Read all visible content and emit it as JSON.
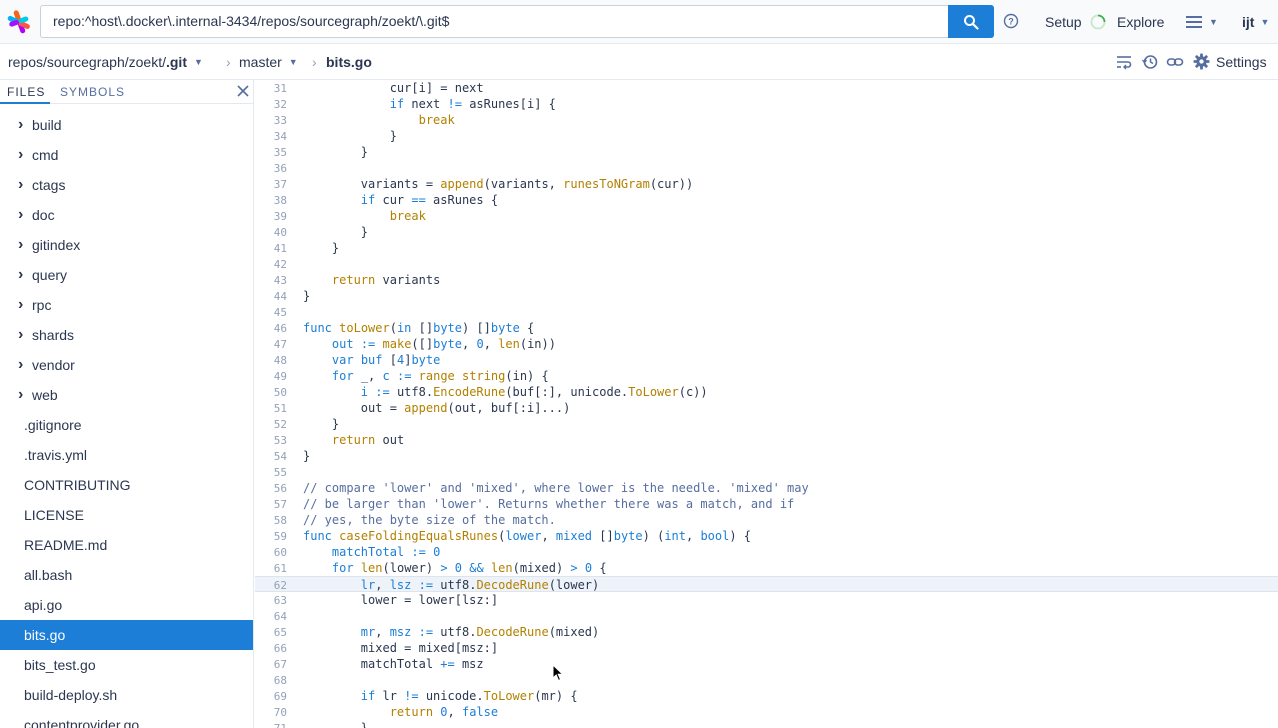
{
  "topnav": {
    "query": "repo:^host\\.docker\\.internal-3434/repos/sourcegraph/zoekt/\\.git$",
    "setup_label": "Setup",
    "explore_label": "Explore",
    "user_label": "ijt"
  },
  "repo_header": {
    "repo_prefix": "repos/sourcegraph/zoekt/",
    "repo_name": ".git",
    "branch": "master",
    "file": "bits.go",
    "settings_label": "Settings"
  },
  "sidebar": {
    "tab_files": "FILES",
    "tab_symbols": "SYMBOLS",
    "dirs": [
      "build",
      "cmd",
      "ctags",
      "doc",
      "gitindex",
      "query",
      "rpc",
      "shards",
      "vendor",
      "web"
    ],
    "files": [
      ".gitignore",
      ".travis.yml",
      "CONTRIBUTING",
      "LICENSE",
      "README.md",
      "all.bash",
      "api.go",
      "bits.go",
      "bits_test.go",
      "build-deploy.sh",
      "contentprovider.go"
    ],
    "active_file": "bits.go"
  },
  "code": {
    "first_line": 31,
    "highlighted_line": 62,
    "lines": [
      [
        [
          "            cur[i] = next",
          ""
        ]
      ],
      [
        [
          "            ",
          ""
        ],
        [
          "if",
          "kw"
        ],
        [
          " next ",
          ""
        ],
        [
          "!=",
          "kw"
        ],
        [
          " asRunes[i] {",
          ""
        ]
      ],
      [
        [
          "                ",
          ""
        ],
        [
          "break",
          "fn"
        ]
      ],
      [
        [
          "            }",
          ""
        ]
      ],
      [
        [
          "        }",
          ""
        ]
      ],
      [
        [
          "",
          ""
        ]
      ],
      [
        [
          "        variants = ",
          ""
        ],
        [
          "append",
          "fn"
        ],
        [
          "(variants, ",
          ""
        ],
        [
          "runesToNGram",
          "fn"
        ],
        [
          "(cur))",
          ""
        ]
      ],
      [
        [
          "        ",
          ""
        ],
        [
          "if",
          "kw"
        ],
        [
          " cur ",
          ""
        ],
        [
          "==",
          "kw"
        ],
        [
          " asRunes {",
          ""
        ]
      ],
      [
        [
          "            ",
          ""
        ],
        [
          "break",
          "fn"
        ]
      ],
      [
        [
          "        }",
          ""
        ]
      ],
      [
        [
          "    }",
          ""
        ]
      ],
      [
        [
          "",
          ""
        ]
      ],
      [
        [
          "    ",
          ""
        ],
        [
          "return",
          "fn"
        ],
        [
          " variants",
          ""
        ]
      ],
      [
        [
          "}",
          ""
        ]
      ],
      [
        [
          "",
          ""
        ]
      ],
      [
        [
          "func",
          "kw"
        ],
        [
          " ",
          ""
        ],
        [
          "toLower",
          "fn"
        ],
        [
          "(",
          ""
        ],
        [
          "in",
          "kw"
        ],
        [
          " []",
          ""
        ],
        [
          "byte",
          "kw"
        ],
        [
          ") []",
          ""
        ],
        [
          "byte",
          "kw"
        ],
        [
          " {",
          ""
        ]
      ],
      [
        [
          "    ",
          ""
        ],
        [
          "out",
          "kw"
        ],
        [
          " ",
          ""
        ],
        [
          ":=",
          "kw"
        ],
        [
          " ",
          ""
        ],
        [
          "make",
          "fn"
        ],
        [
          "([]",
          ""
        ],
        [
          "byte",
          "kw"
        ],
        [
          ", ",
          ""
        ],
        [
          "0",
          "nu"
        ],
        [
          ", ",
          ""
        ],
        [
          "len",
          "fn"
        ],
        [
          "(in))",
          ""
        ]
      ],
      [
        [
          "    ",
          ""
        ],
        [
          "var",
          "kw"
        ],
        [
          " ",
          ""
        ],
        [
          "buf",
          "kw"
        ],
        [
          " [",
          ""
        ],
        [
          "4",
          "nu"
        ],
        [
          "]",
          ""
        ],
        [
          "byte",
          "kw"
        ]
      ],
      [
        [
          "    ",
          ""
        ],
        [
          "for",
          "kw"
        ],
        [
          " _, ",
          ""
        ],
        [
          "c",
          "kw"
        ],
        [
          " ",
          ""
        ],
        [
          ":=",
          "kw"
        ],
        [
          " ",
          ""
        ],
        [
          "range",
          "fn"
        ],
        [
          " ",
          ""
        ],
        [
          "string",
          "fn"
        ],
        [
          "(in) {",
          ""
        ]
      ],
      [
        [
          "        ",
          ""
        ],
        [
          "i",
          "kw"
        ],
        [
          " ",
          ""
        ],
        [
          ":=",
          "kw"
        ],
        [
          " utf8.",
          ""
        ],
        [
          "EncodeRune",
          "fn"
        ],
        [
          "(buf[:], unicode.",
          ""
        ],
        [
          "ToLower",
          "fn"
        ],
        [
          "(c))",
          ""
        ]
      ],
      [
        [
          "        out = ",
          ""
        ],
        [
          "append",
          "fn"
        ],
        [
          "(out, buf[:i]...)",
          ""
        ]
      ],
      [
        [
          "    }",
          ""
        ]
      ],
      [
        [
          "    ",
          ""
        ],
        [
          "return",
          "fn"
        ],
        [
          " out",
          ""
        ]
      ],
      [
        [
          "}",
          ""
        ]
      ],
      [
        [
          "",
          ""
        ]
      ],
      [
        [
          "// compare 'lower' and 'mixed', where lower is the needle. 'mixed' may",
          "cm"
        ]
      ],
      [
        [
          "// be larger than 'lower'. Returns whether there was a match, and if",
          "cm"
        ]
      ],
      [
        [
          "// yes, the byte size of the match.",
          "cm"
        ]
      ],
      [
        [
          "func",
          "kw"
        ],
        [
          " ",
          ""
        ],
        [
          "caseFoldingEqualsRunes",
          "fn"
        ],
        [
          "(",
          ""
        ],
        [
          "lower",
          "kw"
        ],
        [
          ", ",
          ""
        ],
        [
          "mixed",
          "kw"
        ],
        [
          " []",
          ""
        ],
        [
          "byte",
          "kw"
        ],
        [
          ") (",
          ""
        ],
        [
          "int",
          "kw"
        ],
        [
          ", ",
          ""
        ],
        [
          "bool",
          "kw"
        ],
        [
          ") {",
          ""
        ]
      ],
      [
        [
          "    ",
          ""
        ],
        [
          "matchTotal",
          "kw"
        ],
        [
          " ",
          ""
        ],
        [
          ":=",
          "kw"
        ],
        [
          " ",
          ""
        ],
        [
          "0",
          "nu"
        ]
      ],
      [
        [
          "    ",
          ""
        ],
        [
          "for",
          "kw"
        ],
        [
          " ",
          ""
        ],
        [
          "len",
          "fn"
        ],
        [
          "(lower) ",
          ""
        ],
        [
          ">",
          "kw"
        ],
        [
          " ",
          ""
        ],
        [
          "0",
          "nu"
        ],
        [
          " ",
          ""
        ],
        [
          "&&",
          "kw"
        ],
        [
          " ",
          ""
        ],
        [
          "len",
          "fn"
        ],
        [
          "(mixed) ",
          ""
        ],
        [
          ">",
          "kw"
        ],
        [
          " ",
          ""
        ],
        [
          "0",
          "nu"
        ],
        [
          " {",
          ""
        ]
      ],
      [
        [
          "        ",
          ""
        ],
        [
          "lr",
          "kw"
        ],
        [
          ", ",
          ""
        ],
        [
          "lsz",
          "kw"
        ],
        [
          " ",
          ""
        ],
        [
          ":=",
          "kw"
        ],
        [
          " utf8.",
          ""
        ],
        [
          "DecodeRune",
          "fn"
        ],
        [
          "(lower)",
          ""
        ]
      ],
      [
        [
          "        lower = lower[lsz:]",
          ""
        ]
      ],
      [
        [
          "",
          ""
        ]
      ],
      [
        [
          "        ",
          ""
        ],
        [
          "mr",
          "kw"
        ],
        [
          ", ",
          ""
        ],
        [
          "msz",
          "kw"
        ],
        [
          " ",
          ""
        ],
        [
          ":=",
          "kw"
        ],
        [
          " utf8.",
          ""
        ],
        [
          "DecodeRune",
          "fn"
        ],
        [
          "(mixed)",
          ""
        ]
      ],
      [
        [
          "        mixed = mixed[msz:]",
          ""
        ]
      ],
      [
        [
          "        matchTotal ",
          ""
        ],
        [
          "+=",
          "kw"
        ],
        [
          " msz",
          ""
        ]
      ],
      [
        [
          "",
          ""
        ]
      ],
      [
        [
          "        ",
          ""
        ],
        [
          "if",
          "kw"
        ],
        [
          " lr ",
          ""
        ],
        [
          "!=",
          "kw"
        ],
        [
          " unicode.",
          ""
        ],
        [
          "ToLower",
          "fn"
        ],
        [
          "(mr) {",
          ""
        ]
      ],
      [
        [
          "            ",
          ""
        ],
        [
          "return",
          "fn"
        ],
        [
          " ",
          ""
        ],
        [
          "0",
          "nu"
        ],
        [
          ", ",
          ""
        ],
        [
          "false",
          "kw"
        ]
      ],
      [
        [
          "        }",
          ""
        ]
      ]
    ]
  }
}
